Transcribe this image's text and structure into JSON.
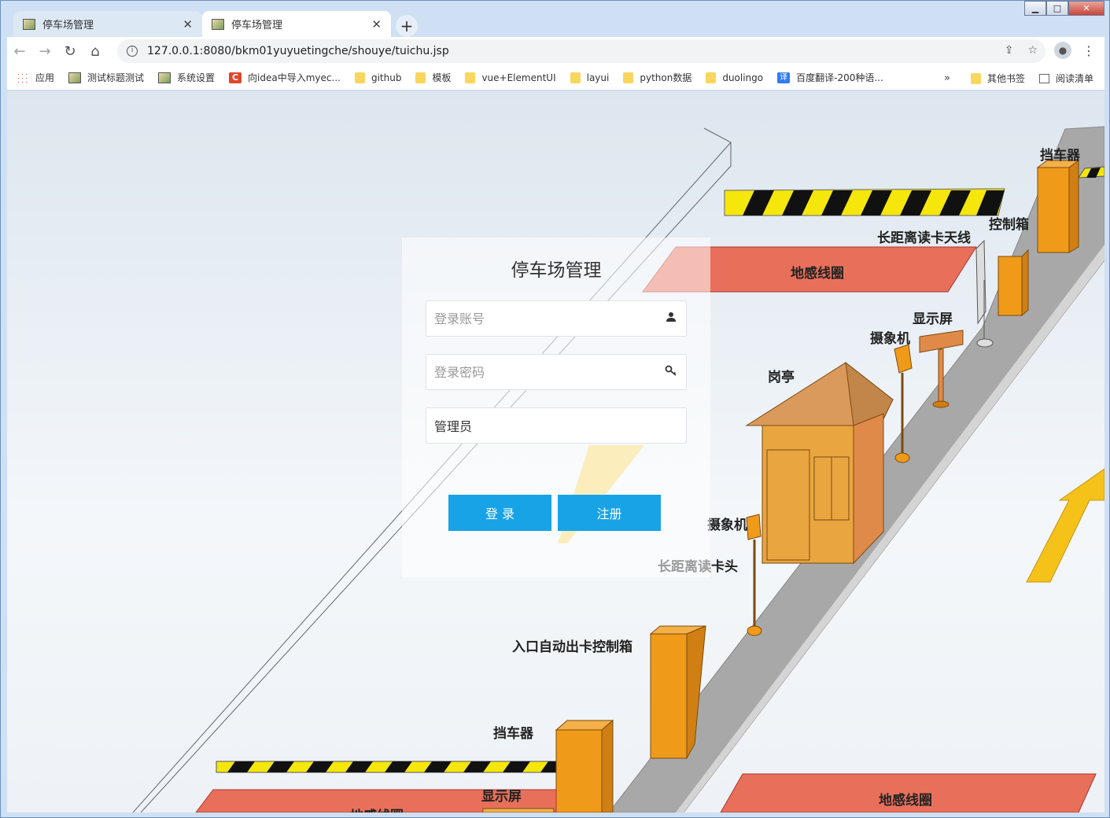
{
  "browser": {
    "tabs": [
      {
        "title": "停车场管理",
        "active": false
      },
      {
        "title": "停车场管理",
        "active": true
      }
    ],
    "address": "127.0.0.1:8080/bkm01yuyuetingche/shouye/tuichu.jsp",
    "bookmarks": [
      {
        "label": "应用",
        "icon": "apps-icon"
      },
      {
        "label": "测试标题测试",
        "icon": "picture-icon"
      },
      {
        "label": "系统设置",
        "icon": "picture-icon"
      },
      {
        "label": "向idea中导入myec...",
        "icon": "c-icon"
      },
      {
        "label": "github",
        "icon": "folder-icon"
      },
      {
        "label": "模板",
        "icon": "folder-icon"
      },
      {
        "label": "vue+ElementUI",
        "icon": "folder-icon"
      },
      {
        "label": "layui",
        "icon": "folder-icon"
      },
      {
        "label": "python数据",
        "icon": "folder-icon"
      },
      {
        "label": "duolingo",
        "icon": "folder-icon"
      },
      {
        "label": "百度翻译-200种语...",
        "icon": "translate-icon"
      }
    ],
    "bookmarks_more": "»",
    "other_bookmarks": "其他书签",
    "reading_list": "阅读清单"
  },
  "login": {
    "title": "停车场管理",
    "account_placeholder": "登录账号",
    "password_placeholder": "登录密码",
    "role_selected": "管理员",
    "login_button": "登 录",
    "register_button": "注册"
  },
  "scene_labels": {
    "barrier_top": "挡车器",
    "control_box": "控制箱",
    "antenna": "长距离读卡天线",
    "loop_top": "地感线圈",
    "display_top": "显示屏",
    "camera_top": "摄象机",
    "booth": "岗亭",
    "camera_mid": "摄象机",
    "card_reader": "长距离读卡头",
    "entry_box": "入口自动出卡控制箱",
    "barrier_bottom": "挡车器",
    "display_bottom": "显示屏",
    "loop_bottom_left": "地感线圈",
    "loop_bottom_right": "地感线圈"
  },
  "colors": {
    "button": "#17a3e6",
    "loop": "#e8705a",
    "road": "#a8a8a8",
    "equipment": "#f09a1a"
  }
}
